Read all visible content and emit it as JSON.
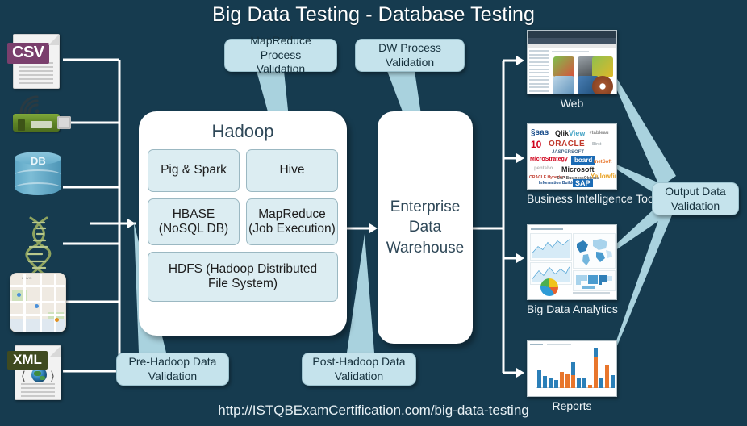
{
  "page": {
    "title": "Big Data Testing - Database Testing",
    "footer_url": "http://ISTQBExamCertification.com/big-data-testing",
    "background_color": "#163b4f",
    "callout_color": "#c5e3ec",
    "pointer_color": "#a9d2de",
    "panel_color": "#ffffff",
    "inner_box_color": "#dcedf2"
  },
  "sources": [
    {
      "name": "csv-file",
      "label": "CSV"
    },
    {
      "name": "sensor-device",
      "label": ""
    },
    {
      "name": "database-cylinder",
      "label": "DB"
    },
    {
      "name": "dna-sequence",
      "label": ""
    },
    {
      "name": "map-data",
      "label": ""
    },
    {
      "name": "xml-file",
      "label": "XML"
    }
  ],
  "hadoop": {
    "title": "Hadoop",
    "components": [
      [
        "Pig & Spark",
        "Hive"
      ],
      [
        "HBASE\n(NoSQL DB)",
        "MapReduce\n(Job Execution)"
      ],
      [
        "HDFS (Hadoop Distributed File System)"
      ]
    ],
    "pig_spark": "Pig & Spark",
    "hive": "Hive",
    "hbase": "HBASE (NoSQL DB)",
    "hbase_l1": "HBASE",
    "hbase_l2": "(NoSQL DB)",
    "mapreduce": "MapReduce (Job Execution)",
    "mapreduce_l1": "MapReduce",
    "mapreduce_l2": "(Job Execution)",
    "hdfs_l1": "HDFS (Hadoop Distributed",
    "hdfs_l2": "File System)"
  },
  "warehouse": {
    "line1": "Enterprise",
    "line2": "Data",
    "line3": "Warehouse"
  },
  "callouts": [
    {
      "name": "mapreduce-process-validation",
      "l1": "MapReduce Process",
      "l2": "Validation"
    },
    {
      "name": "dw-process-validation",
      "l1": "DW Process",
      "l2": "Validation"
    },
    {
      "name": "pre-hadoop-data-validation",
      "l1": "Pre-Hadoop Data",
      "l2": "Validation"
    },
    {
      "name": "post-hadoop-data-validation",
      "l1": "Post-Hadoop Data",
      "l2": "Validation"
    },
    {
      "name": "output-data-validation",
      "l1": "Output Data",
      "l2": "Validation"
    }
  ],
  "callout_mapreduce": {
    "l1": "MapReduce Process",
    "l2": "Validation"
  },
  "callout_dw": {
    "l1": "DW Process",
    "l2": "Validation"
  },
  "callout_pre": {
    "l1": "Pre-Hadoop Data",
    "l2": "Validation"
  },
  "callout_post": {
    "l1": "Post-Hadoop Data",
    "l2": "Validation"
  },
  "callout_output": {
    "l1": "Output Data",
    "l2": "Validation"
  },
  "outputs": [
    {
      "name": "web",
      "caption": "Web"
    },
    {
      "name": "business-intelligence-tools",
      "caption": "Business Intelligence Tools"
    },
    {
      "name": "big-data-analytics",
      "caption": "Big Data Analytics"
    },
    {
      "name": "reports",
      "caption": "Reports"
    }
  ],
  "output_web": {
    "caption": "Web"
  },
  "output_bi": {
    "caption": "Business Intelligence Tools",
    "logos": [
      "SAS",
      "QlikView",
      "tableau",
      "10",
      "ORACLE",
      "JASPERSOFT",
      "MicroStrategy",
      "board",
      "Pentaho",
      "Microsoft",
      "InetSoft",
      "ORACLE Hyperion",
      "SAP BusinessObjects",
      "Yellowfin",
      "Information Builders",
      "SAP"
    ]
  },
  "output_analytics": {
    "caption": "Big Data Analytics"
  },
  "output_reports": {
    "caption": "Reports"
  }
}
